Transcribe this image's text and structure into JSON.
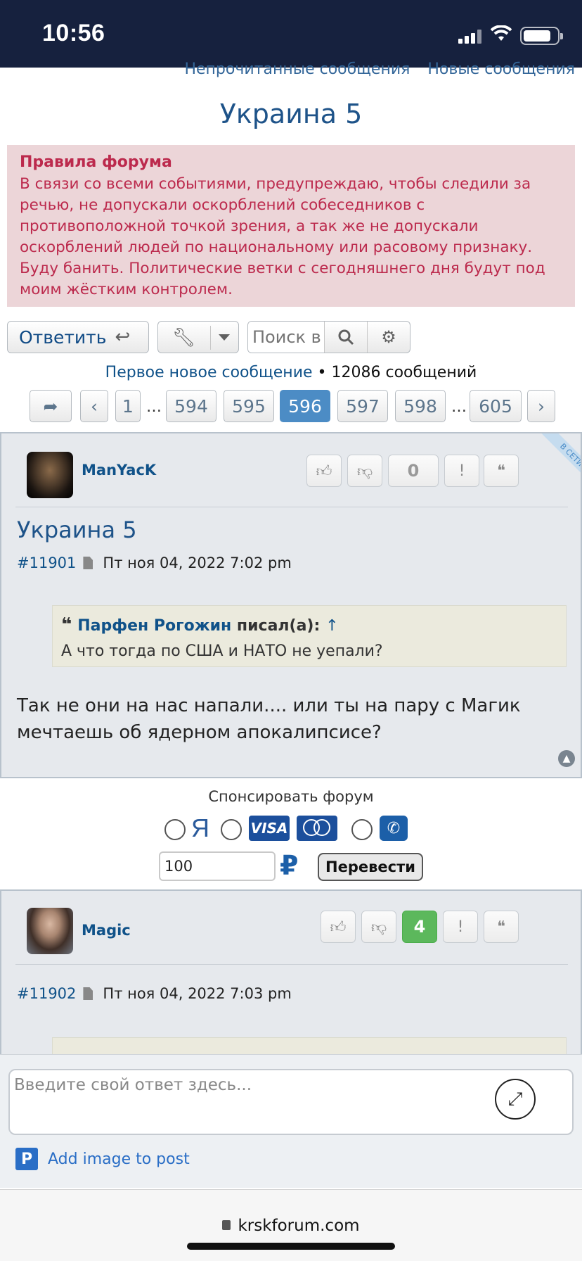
{
  "status_bar": {
    "time": "10:56"
  },
  "top_links": [
    "Непрочитанные сообщения",
    "Новые сообщения"
  ],
  "topic_title": "Украина 5",
  "rules": {
    "title": "Правила форума",
    "text": "В связи со всеми событиями, предупреждаю, чтобы следили за речью, не допускали оскорблений собеседников с противоположной точкой зрения, а так же не допускали оскорблений людей по национальному или расовому признаку. Буду банить. Политические ветки с сегодняшнего дня будут под моим жёстким контролем."
  },
  "toolbar": {
    "reply_label": "Ответить",
    "search_placeholder": "Поиск в"
  },
  "stats": {
    "first_new": "Первое новое сообщение",
    "bullet": "•",
    "count": "12086 сообщений"
  },
  "pagination": {
    "pages": [
      "1",
      "594",
      "595",
      "596",
      "597",
      "598",
      "605"
    ],
    "active": "596",
    "ellipsis": "…"
  },
  "posts": [
    {
      "author": "ManYacK",
      "online_label": "В СЕТИ",
      "score": "0",
      "title": "Украина 5",
      "number": "#11901",
      "date": "Пт ноя 04, 2022 7:02 pm",
      "quote": {
        "author": "Парфен Рогожин",
        "wrote": "писал(а):",
        "arrow": "↑",
        "text": "А что тогда по США и НАТО не уепали?"
      },
      "body": "Так не они на нас напали.... или ты на пару с Магик мечтаешь об ядерном апокалипсисе?"
    },
    {
      "author": "Magic",
      "score": "4",
      "number": "#11902",
      "date": "Пт ноя 04, 2022 7:03 pm"
    }
  ],
  "sponsor": {
    "title": "Спонсировать форум",
    "yandex": "Я",
    "visa": "VISA",
    "amount": "100",
    "currency": "₽",
    "transfer_label": "Перевести"
  },
  "reply_box": {
    "placeholder": "Введите свой ответ здесь...",
    "add_image": "Add image to post"
  },
  "url_bar": {
    "url": "krskforum.com"
  },
  "colors": {
    "status_bar": "#16213e",
    "link": "#105289",
    "rules_bg": "#ecd5d8",
    "rules_text": "#bc2a4d",
    "active_page": "#4c8cc5",
    "score_positive": "#5cb85c"
  }
}
